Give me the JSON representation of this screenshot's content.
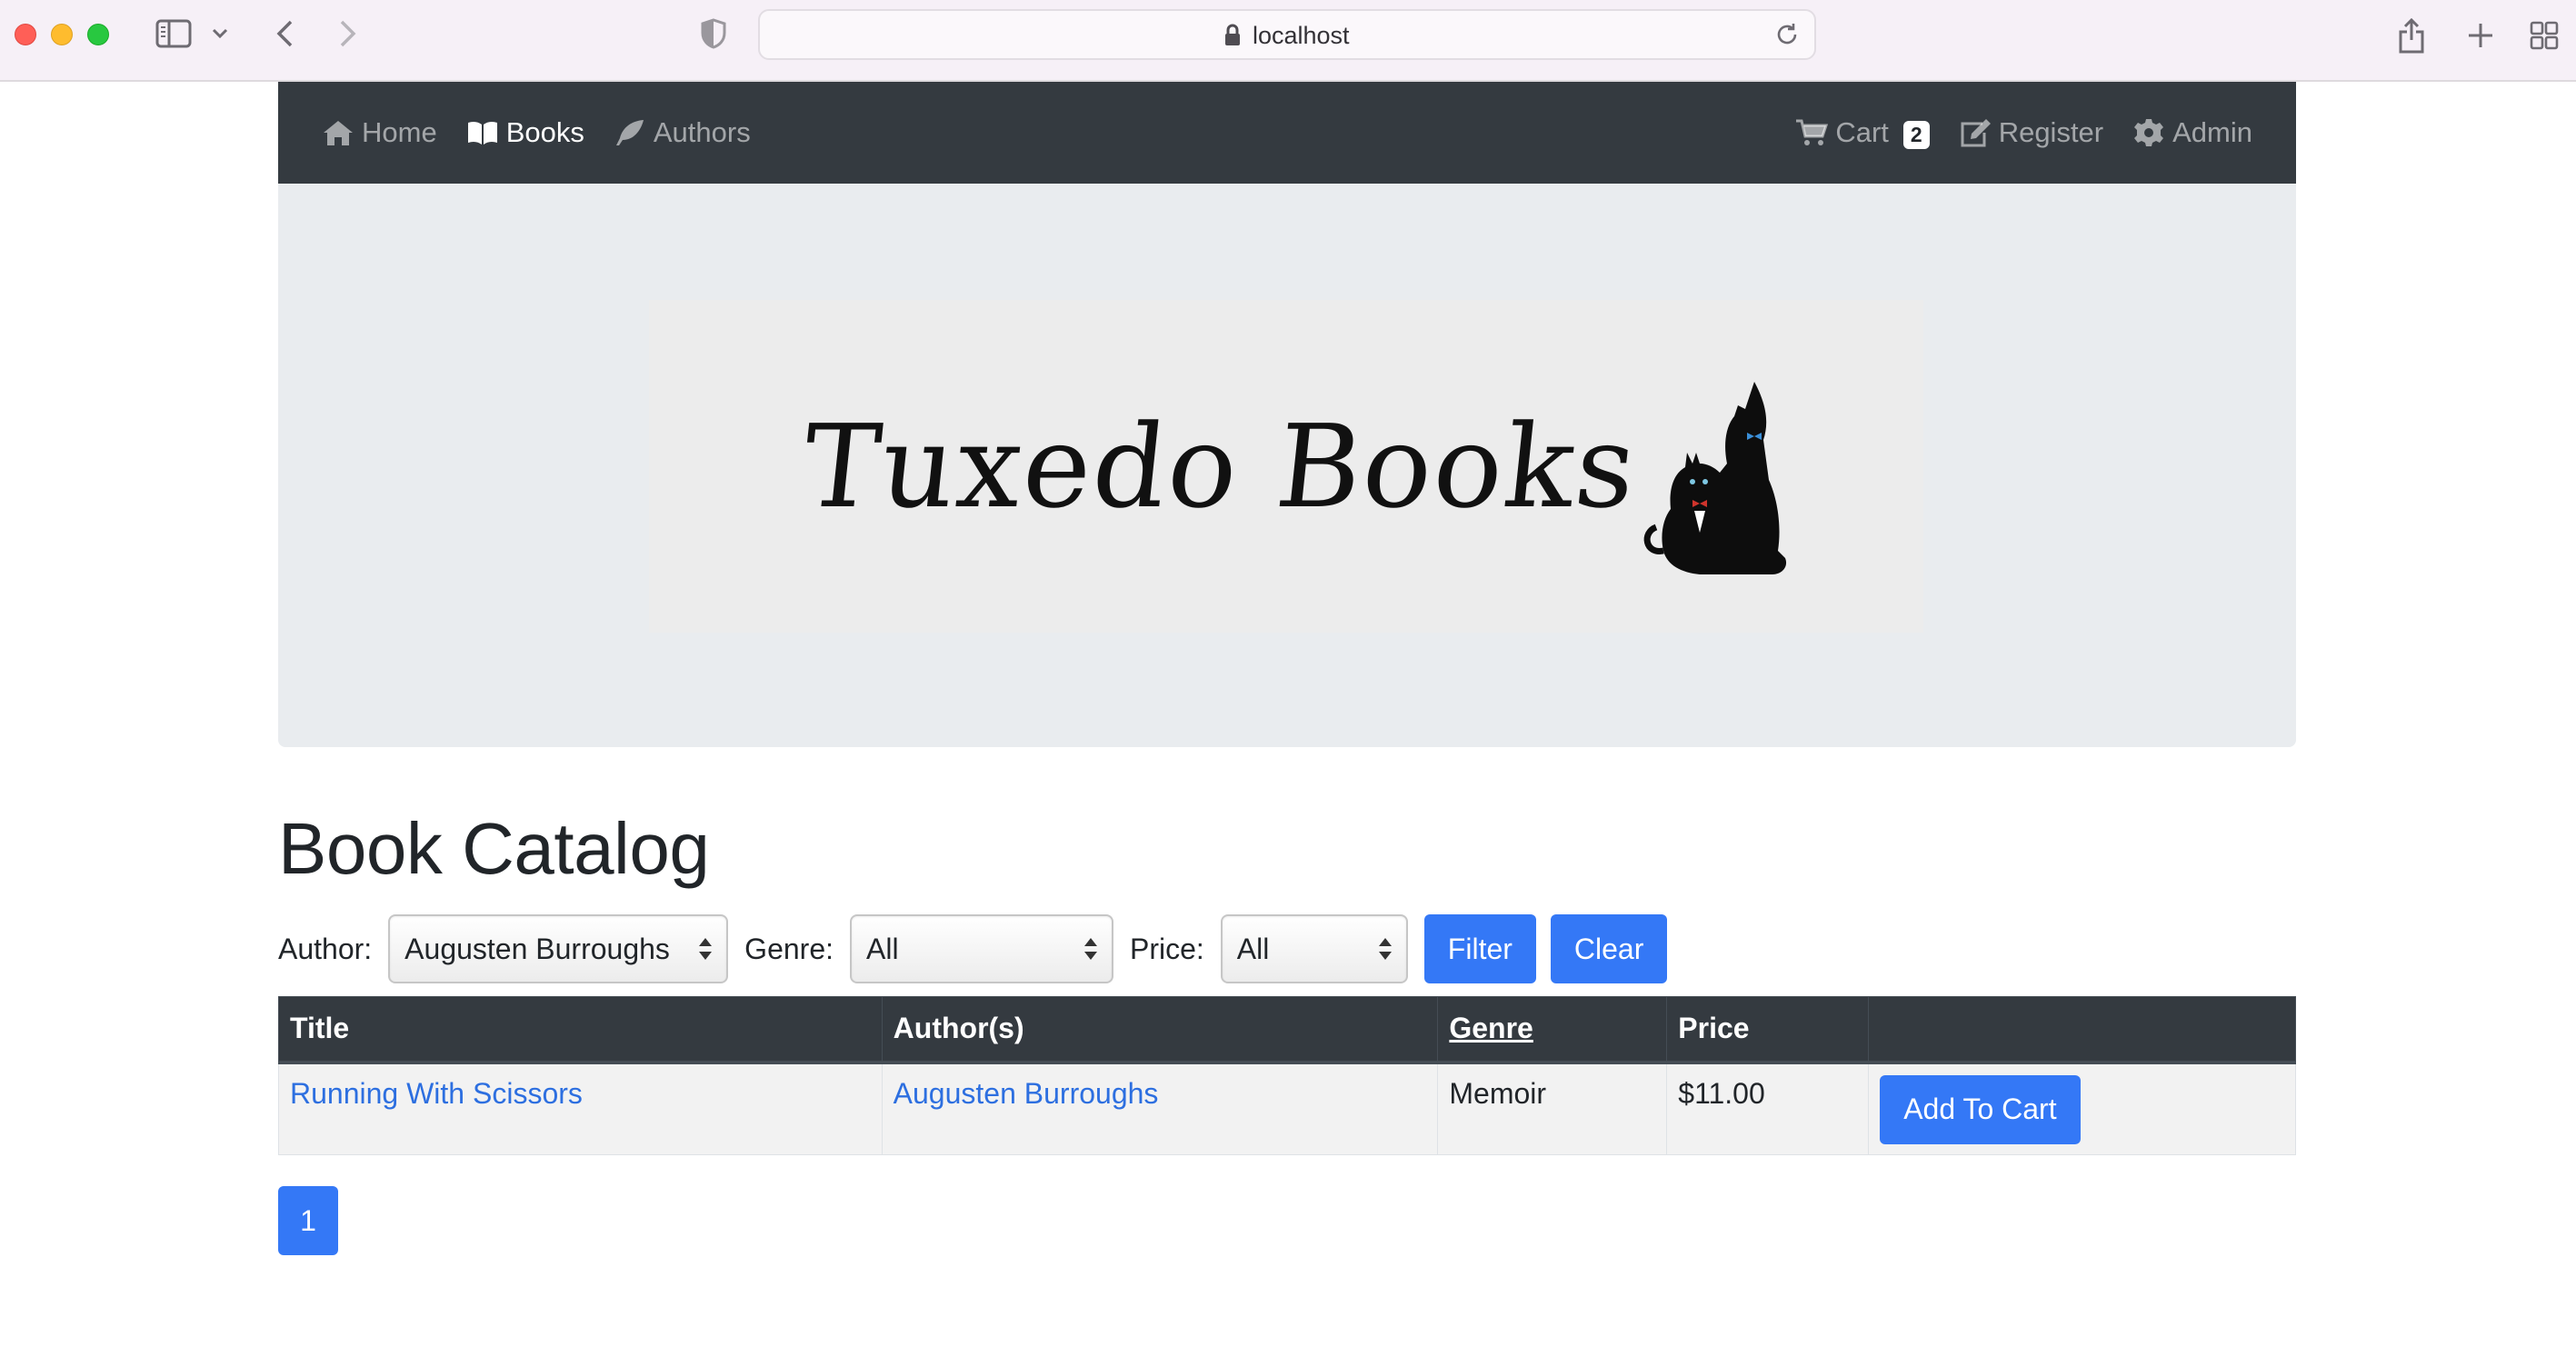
{
  "browser": {
    "url": "localhost"
  },
  "nav": {
    "left": [
      {
        "label": "Home",
        "icon": "home-icon",
        "active": false
      },
      {
        "label": "Books",
        "icon": "book-icon",
        "active": true
      },
      {
        "label": "Authors",
        "icon": "feather-icon",
        "active": false
      }
    ],
    "cart_label": "Cart",
    "cart_count": "2",
    "register_label": "Register",
    "admin_label": "Admin"
  },
  "banner": {
    "logo_text": "Tuxedo Books"
  },
  "page": {
    "title": "Book Catalog"
  },
  "filters": {
    "author_label": "Author:",
    "author_value": "Augusten Burroughs",
    "genre_label": "Genre:",
    "genre_value": "All",
    "price_label": "Price:",
    "price_value": "All",
    "filter_button": "Filter",
    "clear_button": "Clear"
  },
  "table": {
    "headers": [
      "Title",
      "Author(s)",
      "Genre",
      "Price",
      ""
    ],
    "rows": [
      {
        "title": "Running With Scissors",
        "author": "Augusten Burroughs",
        "genre": "Memoir",
        "price": "$11.00",
        "action": "Add To Cart"
      }
    ]
  },
  "pagination": {
    "current": "1"
  },
  "colors": {
    "navbar": "#343a40",
    "primary": "#3478f6",
    "link": "#2d6fe0",
    "jumbotron": "#e9ecef"
  }
}
